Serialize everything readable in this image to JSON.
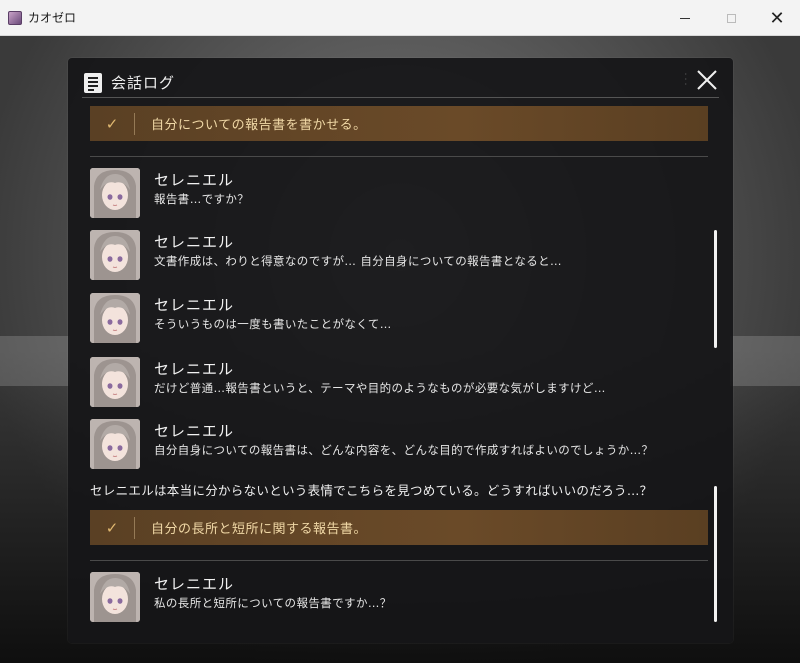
{
  "window": {
    "title": "カオゼロ",
    "controls": {
      "minimize": "minimize",
      "maximize": "maximize",
      "close": "✕"
    }
  },
  "panel": {
    "title": "会話ログ",
    "close_label": "✕"
  },
  "entries": [
    {
      "kind": "choice",
      "text": "自分についての報告書を書かせる。",
      "check": "✓"
    },
    {
      "kind": "message",
      "speaker": "セレニエル",
      "text": "報告書…ですか？"
    },
    {
      "kind": "message",
      "speaker": "セレニエル",
      "text": "文書作成は、わりと得意なのですが… 自分自身についての報告書となると…"
    },
    {
      "kind": "message",
      "speaker": "セレニエル",
      "text": "そういうものは一度も書いたことがなくて…"
    },
    {
      "kind": "message",
      "speaker": "セレニエル",
      "text": "だけど普通…報告書というと、テーマや目的のようなものが必要な気がしますけど…"
    },
    {
      "kind": "message",
      "speaker": "セレニエル",
      "text": "自分自身についての報告書は、どんな内容を、どんな目的で作成すればよいのでしょうか…？"
    },
    {
      "kind": "narration",
      "text": "セレニエルは本当に分からないという表情でこちらを見つめている。どうすればいいのだろう…？"
    },
    {
      "kind": "choice",
      "text": "自分の長所と短所に関する報告書。",
      "check": "✓"
    },
    {
      "kind": "message",
      "speaker": "セレニエル",
      "text": "私の長所と短所についての報告書ですか…？"
    }
  ],
  "colors": {
    "choice_bg": "#6a4a28",
    "choice_text": "#f0d8a6",
    "check": "#e0b870",
    "panel_bg": "#161618"
  },
  "icons": {
    "app": "app-icon",
    "log": "document-list-icon",
    "close": "close-icon",
    "check": "check-icon"
  }
}
